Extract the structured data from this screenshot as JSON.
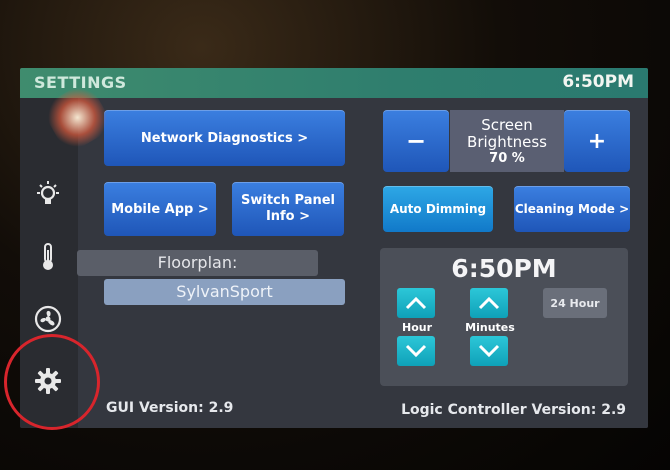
{
  "header": {
    "title": "SETTINGS",
    "time": "6:50PM"
  },
  "sidebar": {
    "items": [
      {
        "name": "lighting",
        "icon": "lightbulb-icon"
      },
      {
        "name": "temperature",
        "icon": "thermometer-icon"
      },
      {
        "name": "fan",
        "icon": "fan-icon"
      },
      {
        "name": "settings",
        "icon": "gear-icon"
      }
    ]
  },
  "buttons": {
    "network_diagnostics": "Network Diagnostics >",
    "mobile_app": "Mobile App >",
    "switch_panel_info": "Switch Panel Info >",
    "auto_dimming": "Auto Dimming",
    "cleaning_mode": "Cleaning Mode >",
    "hour_24": "24 Hour"
  },
  "brightness": {
    "label": "Screen Brightness",
    "value": "70 %",
    "decrease": "−",
    "increase": "+"
  },
  "floorplan": {
    "label": "Floorplan:",
    "value": "SylvanSport"
  },
  "clock": {
    "time": "6:50PM",
    "hour_label": "Hour",
    "minutes_label": "Minutes"
  },
  "footer": {
    "gui_version": "GUI Version: 2.9",
    "logic_version": "Logic Controller Version: 2.9"
  },
  "colors": {
    "accent_blue": "#2a6ad0",
    "teal": "#1ab3c8",
    "topbar": "#3a8a6f",
    "annotation_red": "#d8252c"
  }
}
